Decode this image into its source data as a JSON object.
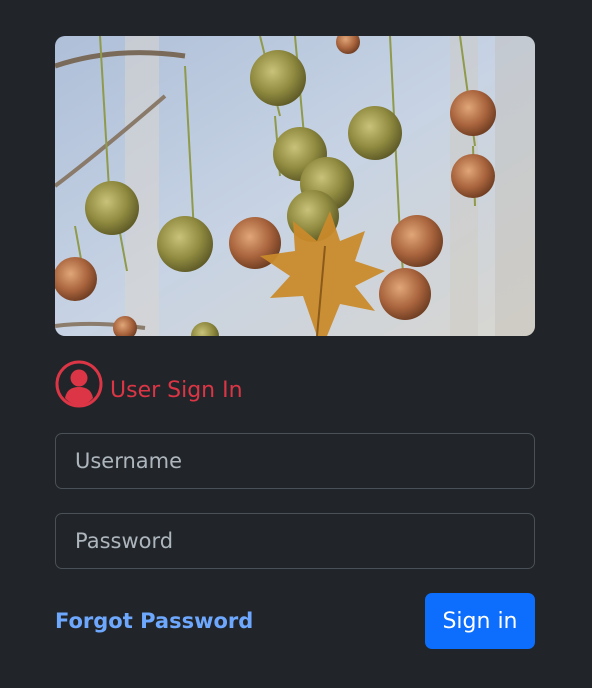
{
  "hero_image": {
    "icon": "sycamore-seed-balls-photo"
  },
  "heading": {
    "icon": "user-circle-icon",
    "title": "User Sign In"
  },
  "form": {
    "username_placeholder": "Username",
    "password_placeholder": "Password",
    "forgot_label": "Forgot Password",
    "submit_label": "Sign in"
  },
  "colors": {
    "background": "#212529",
    "accent_red": "#dc3545",
    "link_blue": "#6ea8fe",
    "button_blue": "#0d6efd"
  }
}
